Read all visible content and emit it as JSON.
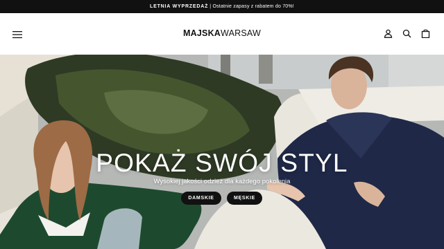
{
  "announcement": {
    "highlight": "LETNIA WYPRZEDAŻ",
    "separator": " | ",
    "text": "Ostatnie zapasy z rabatem do 70%!"
  },
  "header": {
    "logo_part1": "MAJSKA",
    "logo_part2": "WARSAW",
    "icons": [
      "menu-icon",
      "account-icon",
      "search-icon",
      "cart-icon"
    ]
  },
  "hero": {
    "title": "POKAŻ SWÓJ STYL",
    "subtitle": "Wysokiej jakości odzież dla każdego pokolenia",
    "buttons": {
      "women": "DAMSKIE",
      "men": "MĘSKIE"
    }
  },
  "colors": {
    "announcement_bg": "#111111",
    "button_bg": "#111111",
    "text_light": "#ffffff"
  }
}
